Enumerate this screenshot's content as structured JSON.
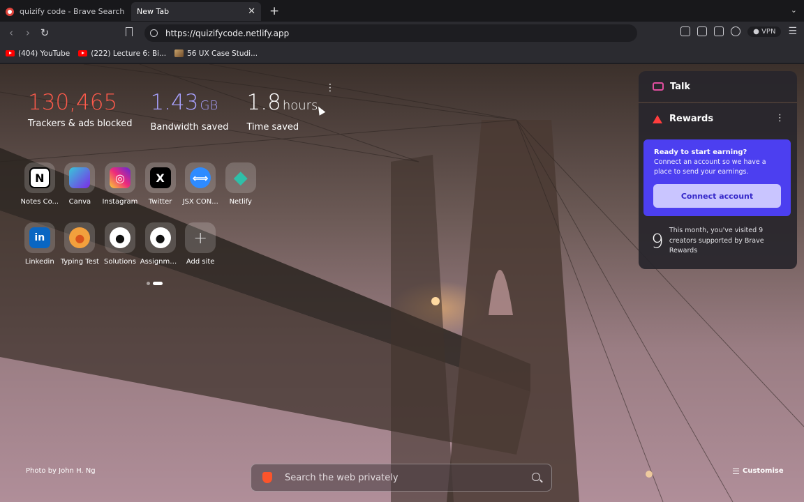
{
  "tabs": [
    {
      "title": "quizify code - Brave Search",
      "active": false
    },
    {
      "title": "New Tab",
      "active": true
    }
  ],
  "toolbar": {
    "url": "https://quizifycode.netlify.app",
    "vpn_label": "VPN"
  },
  "bookmarks": [
    {
      "label": "(404) YouTube",
      "icon": "youtube-icon"
    },
    {
      "label": "(222) Lecture 6: Bi...",
      "icon": "youtube-icon"
    },
    {
      "label": "56 UX Case Studi...",
      "icon": "image-icon"
    }
  ],
  "stats": {
    "trackers": {
      "value": "130,465",
      "label": "Trackers & ads blocked"
    },
    "bandwidth": {
      "value": "1.43",
      "unit": "GB",
      "label": "Bandwidth saved"
    },
    "time": {
      "value": "1.8",
      "unit": "hours",
      "label": "Time saved"
    }
  },
  "top_sites": [
    {
      "name": "Notes Co...",
      "glyph": "N",
      "bg": "#ffffff",
      "fg": "#000000"
    },
    {
      "name": "Canva",
      "glyph": "",
      "bg": "#7d2ae8",
      "fg": "#ffffff"
    },
    {
      "name": "Instagram",
      "glyph": "◎",
      "bg": "#e1306c",
      "fg": "#ffffff"
    },
    {
      "name": "Twitter",
      "glyph": "X",
      "bg": "#000000",
      "fg": "#ffffff"
    },
    {
      "name": "JSX CON...",
      "glyph": "⟺",
      "bg": "#2e8bff",
      "fg": "#ffffff"
    },
    {
      "name": "Netlify",
      "glyph": "◆",
      "bg": "transparent",
      "fg": "#2fbfa8"
    },
    {
      "name": "Linkedin",
      "glyph": "in",
      "bg": "#0a66c2",
      "fg": "#ffffff"
    },
    {
      "name": "Typing Test",
      "glyph": "●",
      "bg": "#f2a03d",
      "fg": "#d9541c"
    },
    {
      "name": "Solutions",
      "glyph": "●",
      "bg": "#ffffff",
      "fg": "#111111"
    },
    {
      "name": "Assignme...",
      "glyph": "●",
      "bg": "#ffffff",
      "fg": "#111111"
    },
    {
      "name": "Add site",
      "glyph": "+",
      "bg": "transparent",
      "fg": "#dddddd"
    }
  ],
  "panel": {
    "talk_label": "Talk",
    "rewards_label": "Rewards",
    "promo_title": "Ready to start earning?",
    "promo_text": "Connect an account so we have a place to send your earnings.",
    "connect_button": "Connect account",
    "visited_count": "9",
    "visited_text": "This month, you've visited 9 creators supported by Brave Rewards"
  },
  "bottom": {
    "photo_credit": "Photo by John H. Ng",
    "search_placeholder": "Search the web privately",
    "customise_label": "Customise"
  },
  "colors": {
    "trackers": "#ff5a4b",
    "bandwidth": "#a9a2ff",
    "promo_bg": "#4c3ff0",
    "brave_orange": "#fb542b"
  }
}
